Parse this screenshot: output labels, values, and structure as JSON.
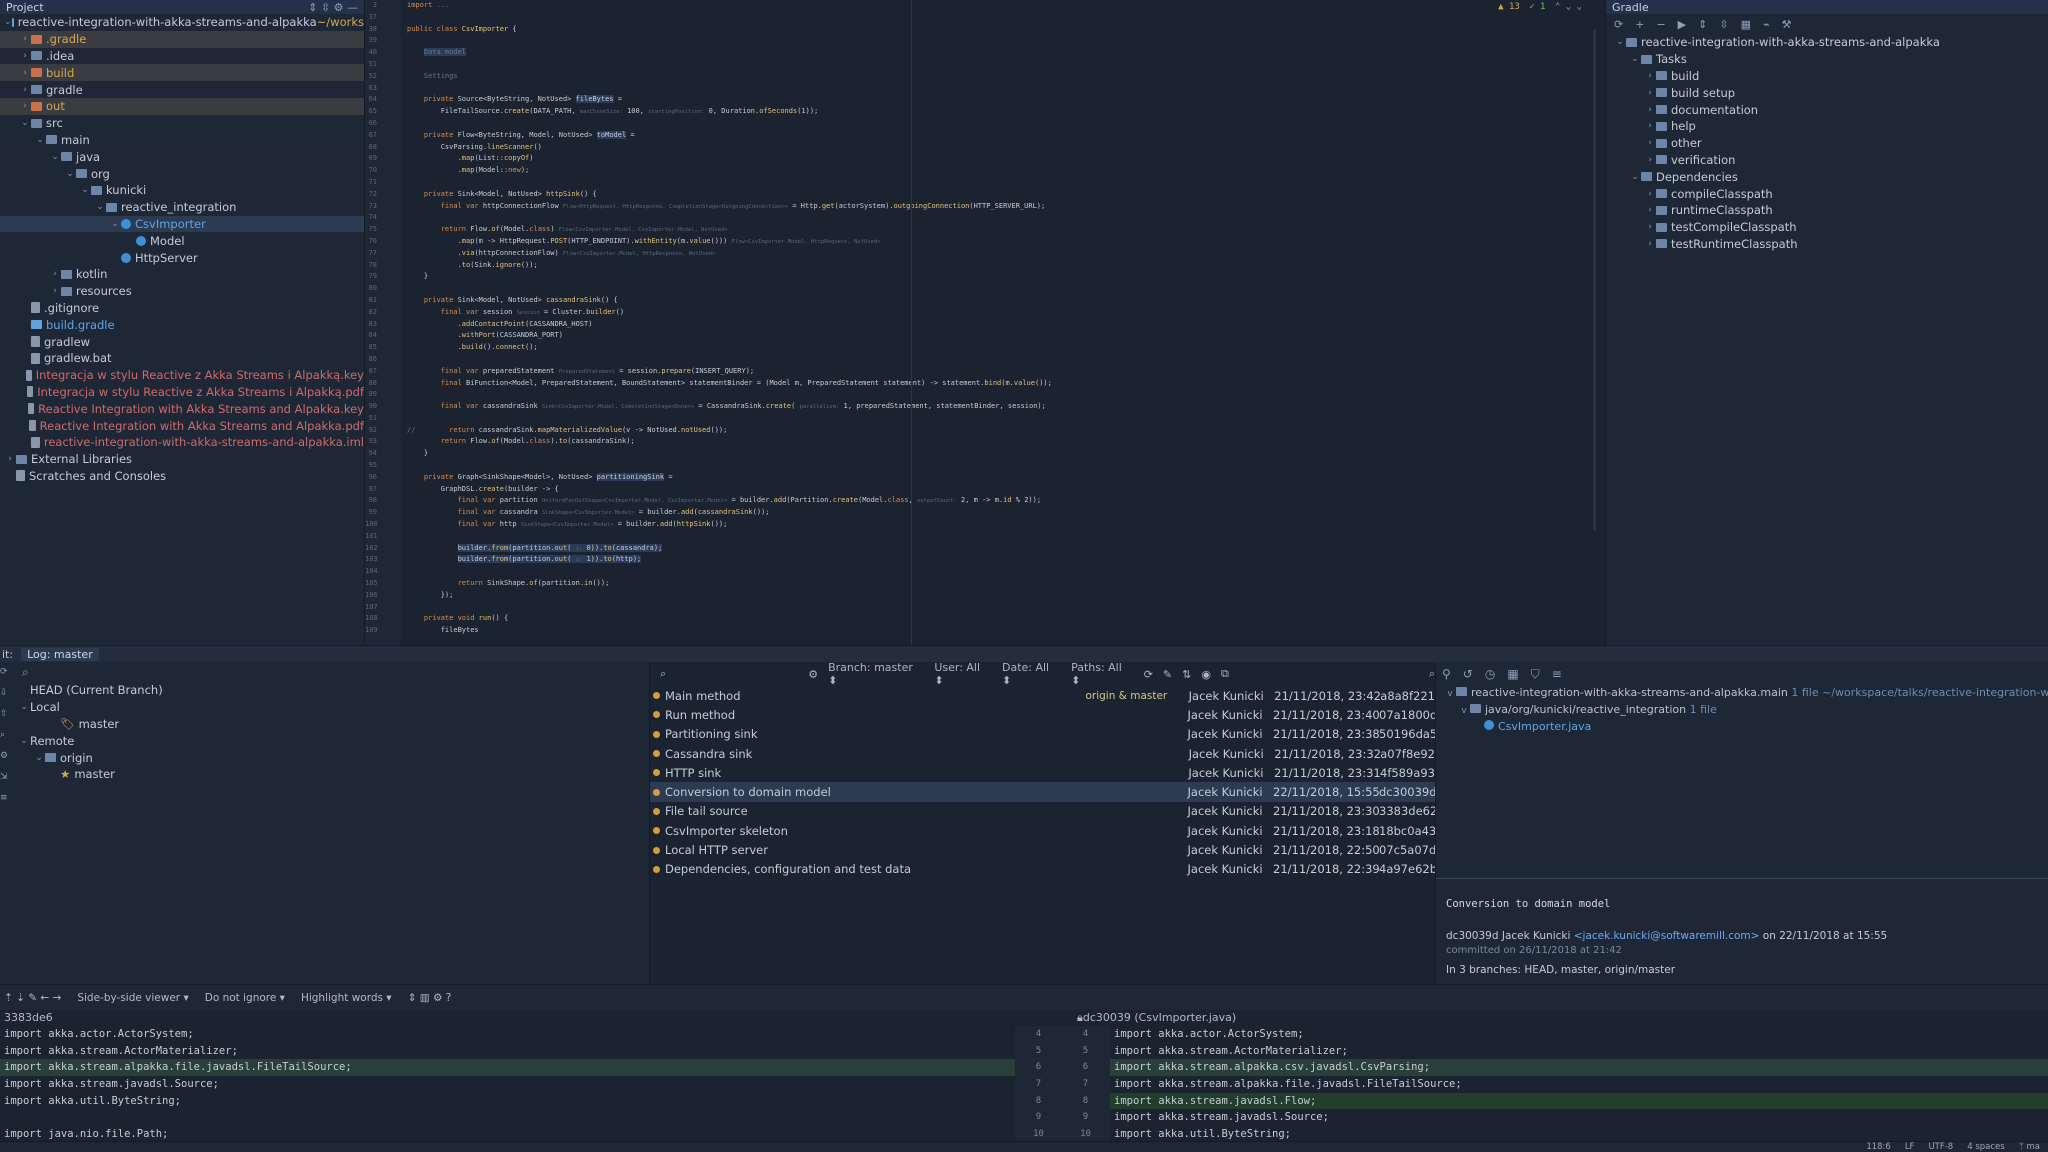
{
  "project_panel": {
    "title": "Project",
    "tree": [
      {
        "label": "reactive-integration-with-akka-streams-and-alpakka",
        "suffix": " ~/works",
        "indent": 0,
        "arrow": "v",
        "icon": "gradle",
        "cls": "",
        "row": ""
      },
      {
        "label": ".gradle",
        "indent": 1,
        "arrow": ">",
        "icon": "orange",
        "cls": "c-orange",
        "row": "hl"
      },
      {
        "label": ".idea",
        "indent": 1,
        "arrow": ">",
        "icon": "folder",
        "cls": "",
        "row": ""
      },
      {
        "label": "build",
        "indent": 1,
        "arrow": ">",
        "icon": "orange",
        "cls": "c-orange",
        "row": "hl"
      },
      {
        "label": "gradle",
        "indent": 1,
        "arrow": ">",
        "icon": "folder",
        "cls": "",
        "row": ""
      },
      {
        "label": "out",
        "indent": 1,
        "arrow": ">",
        "icon": "orange",
        "cls": "c-orange",
        "row": "hl"
      },
      {
        "label": "src",
        "indent": 1,
        "arrow": "v",
        "icon": "folder",
        "cls": "",
        "row": ""
      },
      {
        "label": "main",
        "indent": 2,
        "arrow": "v",
        "icon": "folder",
        "cls": "",
        "row": ""
      },
      {
        "label": "java",
        "indent": 3,
        "arrow": "v",
        "icon": "folder",
        "cls": "",
        "row": ""
      },
      {
        "label": "org",
        "indent": 4,
        "arrow": "v",
        "icon": "folder",
        "cls": "",
        "row": ""
      },
      {
        "label": "kunicki",
        "indent": 5,
        "arrow": "v",
        "icon": "folder",
        "cls": "",
        "row": ""
      },
      {
        "label": "reactive_integration",
        "indent": 6,
        "arrow": "v",
        "icon": "folder",
        "cls": "",
        "row": ""
      },
      {
        "label": "CsvImporter",
        "indent": 7,
        "arrow": "v",
        "icon": "java",
        "cls": "c-blue",
        "row": "sel"
      },
      {
        "label": "Model",
        "indent": 8,
        "arrow": "",
        "icon": "java",
        "cls": "",
        "row": ""
      },
      {
        "label": "HttpServer",
        "indent": 7,
        "arrow": "",
        "icon": "java",
        "cls": "",
        "row": ""
      },
      {
        "label": "kotlin",
        "indent": 3,
        "arrow": ">",
        "icon": "folder",
        "cls": "",
        "row": ""
      },
      {
        "label": "resources",
        "indent": 3,
        "arrow": ">",
        "icon": "folder",
        "cls": "",
        "row": ""
      },
      {
        "label": ".gitignore",
        "indent": 1,
        "arrow": "",
        "icon": "file",
        "cls": "",
        "row": ""
      },
      {
        "label": "build.gradle",
        "indent": 1,
        "arrow": "",
        "icon": "gradle",
        "cls": "c-blue",
        "row": ""
      },
      {
        "label": "gradlew",
        "indent": 1,
        "arrow": "",
        "icon": "file",
        "cls": "",
        "row": ""
      },
      {
        "label": "gradlew.bat",
        "indent": 1,
        "arrow": "",
        "icon": "file",
        "cls": "",
        "row": ""
      },
      {
        "label": "Integracja w stylu Reactive z Akka Streams i Alpakką.key",
        "indent": 1,
        "arrow": "",
        "icon": "file",
        "cls": "c-red",
        "row": ""
      },
      {
        "label": "Integracja w stylu Reactive z Akka Streams i Alpakką.pdf",
        "indent": 1,
        "arrow": "",
        "icon": "file",
        "cls": "c-red",
        "row": ""
      },
      {
        "label": "Reactive Integration with Akka Streams and Alpakka.key",
        "indent": 1,
        "arrow": "",
        "icon": "file",
        "cls": "c-red",
        "row": ""
      },
      {
        "label": "Reactive Integration with Akka Streams and Alpakka.pdf",
        "indent": 1,
        "arrow": "",
        "icon": "file",
        "cls": "c-red",
        "row": ""
      },
      {
        "label": "reactive-integration-with-akka-streams-and-alpakka.iml",
        "indent": 1,
        "arrow": "",
        "icon": "file",
        "cls": "c-red",
        "row": ""
      },
      {
        "label": "External Libraries",
        "indent": 0,
        "arrow": ">",
        "icon": "folder",
        "cls": "",
        "row": ""
      },
      {
        "label": "Scratches and Consoles",
        "indent": 0,
        "arrow": "",
        "icon": "file",
        "cls": "",
        "row": ""
      }
    ]
  },
  "editor": {
    "warnings": "▲ 13",
    "checks": "✓ 1",
    "lines": [
      {
        "n": "3",
        "html": "<span class='kw'>import</span> <span class='cm'>...</span>"
      },
      {
        "n": "37",
        "html": ""
      },
      {
        "n": "38",
        "html": "<span class='kw'>public class</span> <span class='fn'>CsvImporter</span> {"
      },
      {
        "n": "39",
        "html": ""
      },
      {
        "n": "40",
        "html": "    <span class='cm sel-bg'>Data model</span>"
      },
      {
        "n": "51",
        "html": ""
      },
      {
        "n": "52",
        "html": "    <span class='cm'>Settings</span>"
      },
      {
        "n": "63",
        "html": ""
      },
      {
        "n": "64",
        "html": "    <span class='kw'>private</span> Source&lt;ByteString, NotUsed&gt; <span class='sel-bg'>fileBytes</span> ="
      },
      {
        "n": "65",
        "html": "        FileTailSource.<span class='fn'>create</span>(DATA_PATH, <span class='hint'>maxChunkSize:</span> 100, <span class='hint'>startingPosition:</span> 0, Duration.<span class='fn'>ofSeconds</span>(1));"
      },
      {
        "n": "66",
        "html": ""
      },
      {
        "n": "67",
        "html": "    <span class='kw'>private</span> Flow&lt;ByteString, Model, NotUsed&gt; <span class='sel-bg'>toModel</span> ="
      },
      {
        "n": "68",
        "html": "        CsvParsing.<span class='fn'>lineScanner</span>()"
      },
      {
        "n": "69",
        "html": "            .<span class='fn'>map</span>(List::<span class='fn'>copyOf</span>)"
      },
      {
        "n": "70",
        "html": "            .<span class='fn'>map</span>(Model::<span class='kw'>new</span>);"
      },
      {
        "n": "71",
        "html": ""
      },
      {
        "n": "72",
        "html": "    <span class='kw'>private</span> Sink&lt;Model, NotUsed&gt; <span class='fn'>httpSink</span>() {"
      },
      {
        "n": "73",
        "html": "        <span class='kw'>final var</span> httpConnectionFlow <span class='hint'>Flow&lt;HttpRequest, HttpResponse, CompletionStage&lt;OutgoingConnection&gt;&gt;</span> = Http.<span class='fn'>get</span>(actorSystem).<span class='fn'>outgoingConnection</span>(HTTP_SERVER_URL);"
      },
      {
        "n": "74",
        "html": ""
      },
      {
        "n": "75",
        "html": "        <span class='kw'>return</span> Flow.<span class='fn'>of</span>(Model.<span class='kw'>class</span>) <span class='hint'>Flow&lt;CsvImporter.Model, CsvImporter.Model, NotUsed&gt;</span>"
      },
      {
        "n": "76",
        "html": "            .<span class='fn'>map</span>(m -&gt; HttpRequest.<span class='fn'>POST</span>(HTTP_ENDPOINT).<span class='fn'>withEntity</span>(m.<span class='fn'>value</span>())) <span class='hint'>Flow&lt;CsvImporter.Model, HttpRequest, NotUsed&gt;</span>"
      },
      {
        "n": "77",
        "html": "            .<span class='fn'>via</span>(httpConnectionFlow) <span class='hint'>Flow&lt;CsvImporter.Model, HttpResponse, NotUsed&gt;</span>"
      },
      {
        "n": "78",
        "html": "            .<span class='fn'>to</span>(Sink.<span class='fn'>ignore</span>());"
      },
      {
        "n": "79",
        "html": "    }"
      },
      {
        "n": "80",
        "html": ""
      },
      {
        "n": "81",
        "html": "    <span class='kw'>private</span> Sink&lt;Model, NotUsed&gt; <span class='fn'>cassandraSink</span>() {"
      },
      {
        "n": "82",
        "html": "        <span class='kw'>final var</span> session <span class='hint'>Session</span> = Cluster.<span class='fn'>builder</span>()"
      },
      {
        "n": "83",
        "html": "            .<span class='fn'>addContactPoint</span>(CASSANDRA_HOST)"
      },
      {
        "n": "84",
        "html": "            .<span class='fn'>withPort</span>(CASSANDRA_PORT)"
      },
      {
        "n": "85",
        "html": "            .<span class='fn'>build</span>().<span class='fn'>connect</span>();"
      },
      {
        "n": "86",
        "html": ""
      },
      {
        "n": "87",
        "html": "        <span class='kw'>final var</span> preparedStatement <span class='hint'>PreparedStatement</span> = session.<span class='fn'>prepare</span>(INSERT_QUERY);"
      },
      {
        "n": "88",
        "html": "        <span class='kw'>final</span> BiFunction&lt;Model, PreparedStatement, BoundStatement&gt; statementBinder = (Model m, PreparedStatement statement) -&gt; statement.<span class='fn'>bind</span>(m.<span class='fn'>value</span>());"
      },
      {
        "n": "89",
        "html": ""
      },
      {
        "n": "90",
        "html": "        <span class='kw'>final var</span> cassandraSink <span class='hint'>Sink&lt;CsvImporter.Model, CompletionStage&lt;Done&gt;&gt;</span> = CassandraSink.<span class='fn'>create</span>( <span class='hint'>parallelism:</span> 1, preparedStatement, statementBinder, session);"
      },
      {
        "n": "91",
        "html": ""
      },
      {
        "n": "92",
        "html": "<span class='cm'>//</span>        <span class='kw'>return</span> cassandraSink.<span class='fn'>mapMaterializedValue</span>(v -&gt; NotUsed.<span class='fn'>notUsed</span>());"
      },
      {
        "n": "93",
        "html": "        <span class='kw'>return</span> Flow.<span class='fn'>of</span>(Model.<span class='kw'>class</span>).<span class='fn'>to</span>(cassandraSink);"
      },
      {
        "n": "94",
        "html": "    }"
      },
      {
        "n": "95",
        "html": ""
      },
      {
        "n": "96",
        "html": "    <span class='kw'>private</span> Graph&lt;SinkShape&lt;Model&gt;, NotUsed&gt; <span class='sel-bg'>partitioningSink</span> ="
      },
      {
        "n": "97",
        "html": "        GraphDSL.<span class='fn'>create</span>(builder -&gt; {"
      },
      {
        "n": "98",
        "html": "            <span class='kw'>final var</span> partition <span class='hint'>UniformFanOutShape&lt;CsvImporter.Model, CsvImporter.Model&gt;</span> = builder.<span class='fn'>add</span>(Partition.<span class='fn'>create</span>(Model.<span class='kw'>class</span>, <span class='hint'>outputCount:</span> 2, m -&gt; m.<span class='fn'>id</span> % 2));"
      },
      {
        "n": "99",
        "html": "            <span class='kw'>final var</span> cassandra <span class='hint'>SinkShape&lt;CsvImporter.Model&gt;</span> = builder.<span class='fn'>add</span>(<span class='fn'>cassandraSink</span>());"
      },
      {
        "n": "100",
        "html": "            <span class='kw'>final var</span> http <span class='hint'>SinkShape&lt;CsvImporter.Model&gt;</span> = builder.<span class='fn'>add</span>(<span class='fn'>httpSink</span>());"
      },
      {
        "n": "101",
        "html": ""
      },
      {
        "n": "102",
        "html": "            <span class='sel-bg'>builder.<span class='fn'>from</span>(partition.<span class='fn'>out</span>( <span class='hint'>i:</span> 0)).<span class='fn'>to</span>(cassandra);</span>"
      },
      {
        "n": "103",
        "html": "            <span class='sel-bg'>builder.<span class='fn'>from</span>(partition.<span class='fn'>out</span>( <span class='hint'>i:</span> 1)).<span class='fn'>to</span>(http);</span>"
      },
      {
        "n": "104",
        "html": ""
      },
      {
        "n": "105",
        "html": "            <span class='kw'>return</span> SinkShape.<span class='fn'>of</span>(partition.<span class='fn'>in</span>());"
      },
      {
        "n": "106",
        "html": "        });"
      },
      {
        "n": "107",
        "html": ""
      },
      {
        "n": "108",
        "html": "    <span class='kw'>private void</span> <span class='fn'>run</span>() {"
      },
      {
        "n": "109",
        "html": "        fileBytes"
      }
    ]
  },
  "gradle_panel": {
    "title": "Gradle",
    "tree": [
      {
        "label": "reactive-integration-with-akka-streams-and-alpakka",
        "indent": 0,
        "arrow": "v"
      },
      {
        "label": "Tasks",
        "indent": 1,
        "arrow": "v"
      },
      {
        "label": "build",
        "indent": 2,
        "arrow": ">"
      },
      {
        "label": "build setup",
        "indent": 2,
        "arrow": ">"
      },
      {
        "label": "documentation",
        "indent": 2,
        "arrow": ">"
      },
      {
        "label": "help",
        "indent": 2,
        "arrow": ">"
      },
      {
        "label": "other",
        "indent": 2,
        "arrow": ">"
      },
      {
        "label": "verification",
        "indent": 2,
        "arrow": ">"
      },
      {
        "label": "Dependencies",
        "indent": 1,
        "arrow": "v"
      },
      {
        "label": "compileClasspath",
        "indent": 2,
        "arrow": ">"
      },
      {
        "label": "runtimeClasspath",
        "indent": 2,
        "arrow": ">"
      },
      {
        "label": "testCompileClasspath",
        "indent": 2,
        "arrow": ">"
      },
      {
        "label": "testRuntimeClasspath",
        "indent": 2,
        "arrow": ">"
      }
    ]
  },
  "bottom": {
    "tab_prefix": "it:",
    "tab_label": "Log: master",
    "branches": [
      {
        "label": "HEAD (Current Branch)",
        "indent": 0,
        "arrow": ""
      },
      {
        "label": "Local",
        "indent": 0,
        "arrow": "v"
      },
      {
        "label": "master",
        "indent": 2,
        "arrow": ""
      },
      {
        "label": "Remote",
        "indent": 0,
        "arrow": "v"
      },
      {
        "label": "origin",
        "indent": 1,
        "arrow": "v"
      },
      {
        "label": "master",
        "indent": 2,
        "arrow": ""
      }
    ],
    "filters": {
      "branch": "Branch: master ⬍",
      "user": "User: All ⬍",
      "date": "Date: All ⬍",
      "paths": "Paths: All ⬍"
    },
    "commits": [
      {
        "msg": "Main method",
        "tag": "origin & master",
        "author": "Jacek Kunicki",
        "date": "21/11/2018, 23:42",
        "hash": "a8a8f221"
      },
      {
        "msg": "Run method",
        "tag": "",
        "author": "Jacek Kunicki",
        "date": "21/11/2018, 23:40",
        "hash": "07a1800d"
      },
      {
        "msg": "Partitioning sink",
        "tag": "",
        "author": "Jacek Kunicki",
        "date": "21/11/2018, 23:38",
        "hash": "50196da5"
      },
      {
        "msg": "Cassandra sink",
        "tag": "",
        "author": "Jacek Kunicki",
        "date": "21/11/2018, 23:32",
        "hash": "a07f8e92"
      },
      {
        "msg": "HTTP sink",
        "tag": "",
        "author": "Jacek Kunicki",
        "date": "21/11/2018, 23:31",
        "hash": "4f589a93"
      },
      {
        "msg": "Conversion to domain model",
        "tag": "",
        "author": "Jacek Kunicki",
        "date": "22/11/2018, 15:55",
        "hash": "dc30039d"
      },
      {
        "msg": "File tail source",
        "tag": "",
        "author": "Jacek Kunicki",
        "date": "21/11/2018, 23:30",
        "hash": "3383de62"
      },
      {
        "msg": "CsvImporter skeleton",
        "tag": "",
        "author": "Jacek Kunicki",
        "date": "21/11/2018, 23:18",
        "hash": "18bc0a43"
      },
      {
        "msg": "Local HTTP server",
        "tag": "",
        "author": "Jacek Kunicki",
        "date": "21/11/2018, 22:50",
        "hash": "07c5a07d"
      },
      {
        "msg": "Dependencies, configuration and test data",
        "tag": "",
        "author": "Jacek Kunicki",
        "date": "21/11/2018, 22:39",
        "hash": "4a97e62b"
      }
    ],
    "details": {
      "root": "reactive-integration-with-akka-streams-and-alpakka.main",
      "root_meta": "1 file  ~/workspace/talks/reactive-integration-with-a",
      "pkg": "java/org/kunicki/reactive_integration",
      "pkg_meta": "1 file",
      "file": "CsvImporter.java",
      "subject": "Conversion to domain model",
      "hash_author": "dc30039d Jacek Kunicki",
      "email": "<jacek.kunicki@softwaremill.com>",
      "on_date": "on 22/11/2018 at 15:55",
      "committed": "committed on 26/11/2018 at 21:42",
      "branches": "In 3 branches: HEAD, master, origin/master"
    }
  },
  "diff": {
    "viewer": "Side-by-side viewer ▾",
    "ignore": "Do not ignore ▾",
    "highlight": "Highlight words ▾",
    "left_title": "3383de6",
    "right_title": "dc30039 (CsvImporter.java)",
    "left_lines": [
      {
        "t": "import akka.actor.ActorSystem;",
        "c": ""
      },
      {
        "t": "import akka.stream.ActorMaterializer;",
        "c": ""
      },
      {
        "t": "import akka.stream.alpakka.file.javadsl.FileTailSource;",
        "c": "chg"
      },
      {
        "t": "import akka.stream.javadsl.Source;",
        "c": ""
      },
      {
        "t": "import akka.util.ByteString;",
        "c": ""
      },
      {
        "t": "",
        "c": ""
      },
      {
        "t": "import java.nio.file.Path;",
        "c": ""
      }
    ],
    "gutter": [
      [
        "4",
        "4"
      ],
      [
        "5",
        "5"
      ],
      [
        "6",
        "6"
      ],
      [
        "7",
        "7"
      ],
      [
        "8",
        "8"
      ],
      [
        "9",
        "9"
      ],
      [
        "10",
        "10"
      ]
    ],
    "right_lines": [
      {
        "t": "import akka.actor.ActorSystem;",
        "c": ""
      },
      {
        "t": "import akka.stream.ActorMaterializer;",
        "c": ""
      },
      {
        "t": "import akka.stream.alpakka.csv.javadsl.CsvParsing;",
        "c": "chg"
      },
      {
        "t": "import akka.stream.alpakka.file.javadsl.FileTailSource;",
        "c": ""
      },
      {
        "t": "import akka.stream.javadsl.Flow;",
        "c": "add"
      },
      {
        "t": "import akka.stream.javadsl.Source;",
        "c": ""
      },
      {
        "t": "import akka.util.ByteString;",
        "c": ""
      }
    ]
  },
  "status_bar": {
    "pos": "118:6",
    "lf": "LF",
    "enc": "UTF-8",
    "indent": "4 spaces",
    "branch": "ᛘ ma"
  }
}
